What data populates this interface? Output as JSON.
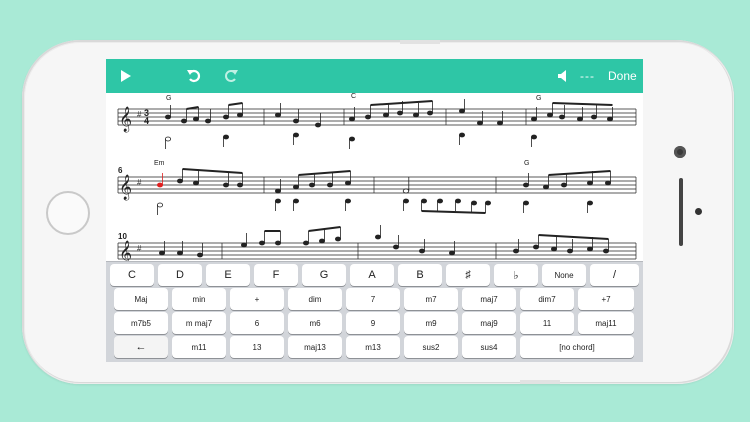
{
  "toolbar": {
    "play_icon": "play-icon",
    "undo_icon": "undo-icon",
    "redo_icon": "redo-icon",
    "volume_icon": "volume-icon",
    "tempo_text": "---",
    "done_label": "Done",
    "bar_color": "#2ec6a6"
  },
  "score": {
    "time_signature": [
      "3",
      "4"
    ],
    "measure_numbers": [
      "6",
      "10"
    ],
    "chords_row1": [
      "G",
      "C",
      "G"
    ],
    "chords_row2": [
      "Em",
      "G"
    ],
    "selected_note_color": "#e02020"
  },
  "keyboard": {
    "notes": [
      "C",
      "D",
      "E",
      "F",
      "G",
      "A",
      "B",
      "♯",
      "♭",
      "None",
      "/"
    ],
    "row2": [
      "Maj",
      "min",
      "+",
      "dim",
      "7",
      "m7",
      "maj7",
      "dim7",
      "+7"
    ],
    "row3": [
      "m7b5",
      "m maj7",
      "6",
      "m6",
      "9",
      "m9",
      "maj9",
      "11",
      "maj11"
    ],
    "row4": [
      "←",
      "m11",
      "13",
      "maj13",
      "m13",
      "sus2",
      "sus4",
      "[no chord]"
    ]
  }
}
